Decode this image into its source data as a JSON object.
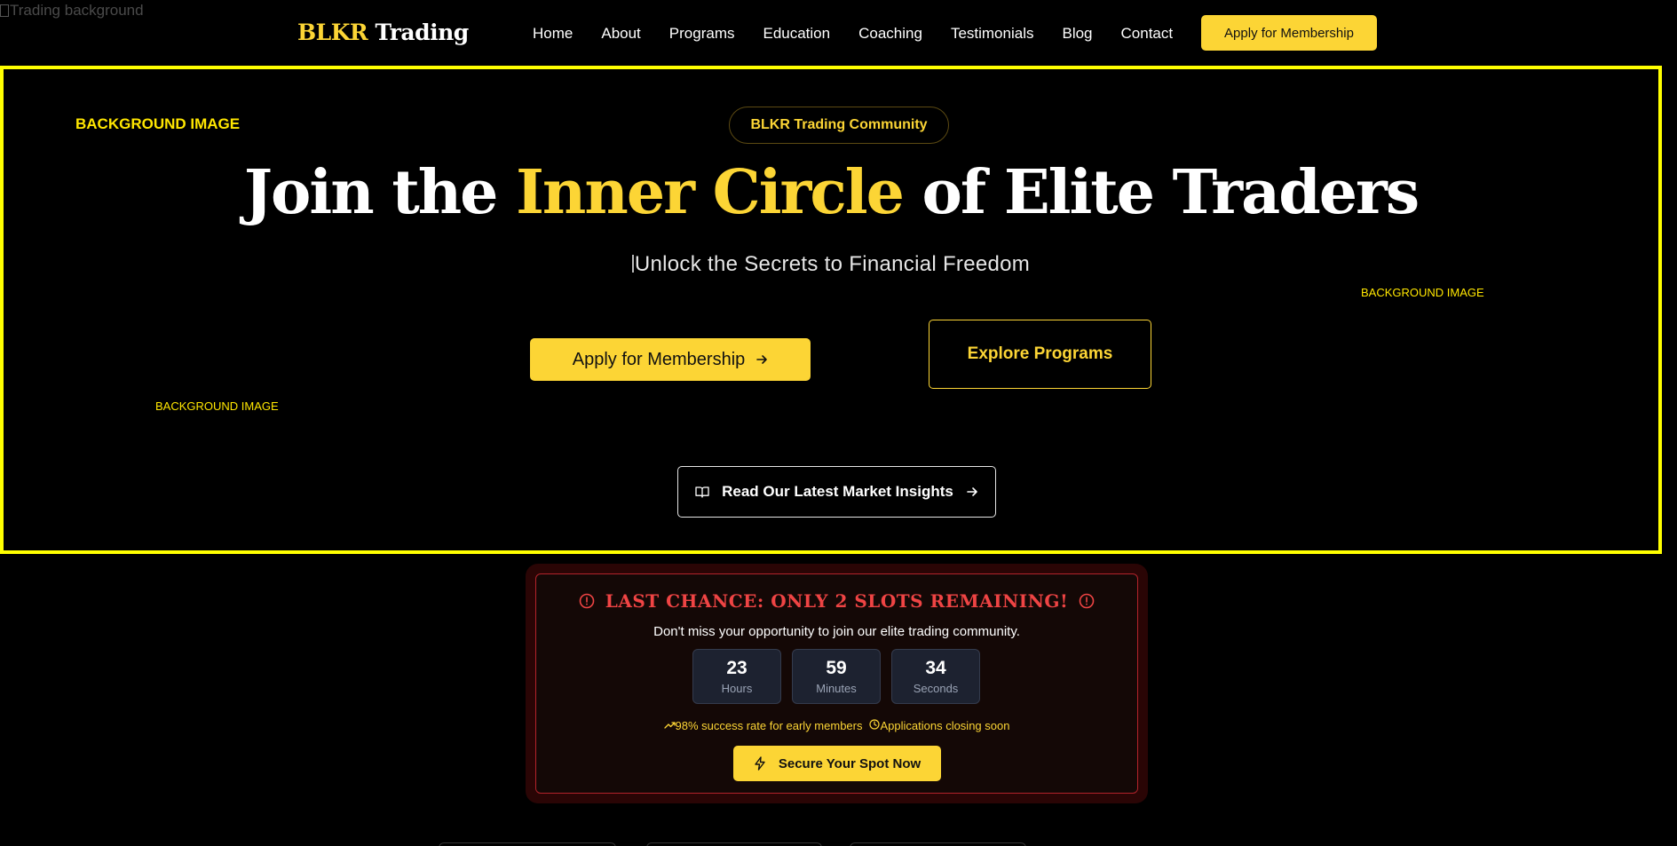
{
  "broken_image": {
    "alt": "Trading background"
  },
  "nav": {
    "logo_accent": "BLKR",
    "logo_rest": "Trading",
    "links": [
      "Home",
      "About",
      "Programs",
      "Education",
      "Coaching",
      "Testimonials",
      "Blog",
      "Contact"
    ],
    "cta": "Apply for Membership"
  },
  "hero": {
    "bg_labels": [
      "BACKGROUND IMAGE",
      "BACKGROUND IMAGE",
      "BACKGROUND IMAGE"
    ],
    "pill": "BLKR Trading Community",
    "headline": {
      "part1": "Join the ",
      "highlight": "Inner Circle",
      "part2": " of Elite Traders"
    },
    "subtitle": "Unlock the Secrets to Financial Freedom",
    "apply_button": "Apply for Membership",
    "explore_button": "Explore Programs",
    "insights_button": "Read Our Latest Market Insights"
  },
  "urgency": {
    "title": "LAST CHANCE: ONLY 2 SLOTS REMAINING!",
    "subtitle": "Don't miss your opportunity to join our elite trading community.",
    "timers": [
      {
        "value": "23",
        "unit": "Hours"
      },
      {
        "value": "59",
        "unit": "Minutes"
      },
      {
        "value": "34",
        "unit": "Seconds"
      }
    ],
    "stat1": "98% success rate for early members",
    "stat2": "Applications closing soon",
    "cta": "Secure Your Spot Now"
  },
  "colors": {
    "accent": "#fcd535",
    "danger": "#ef4444",
    "outline": "#ffff00"
  }
}
